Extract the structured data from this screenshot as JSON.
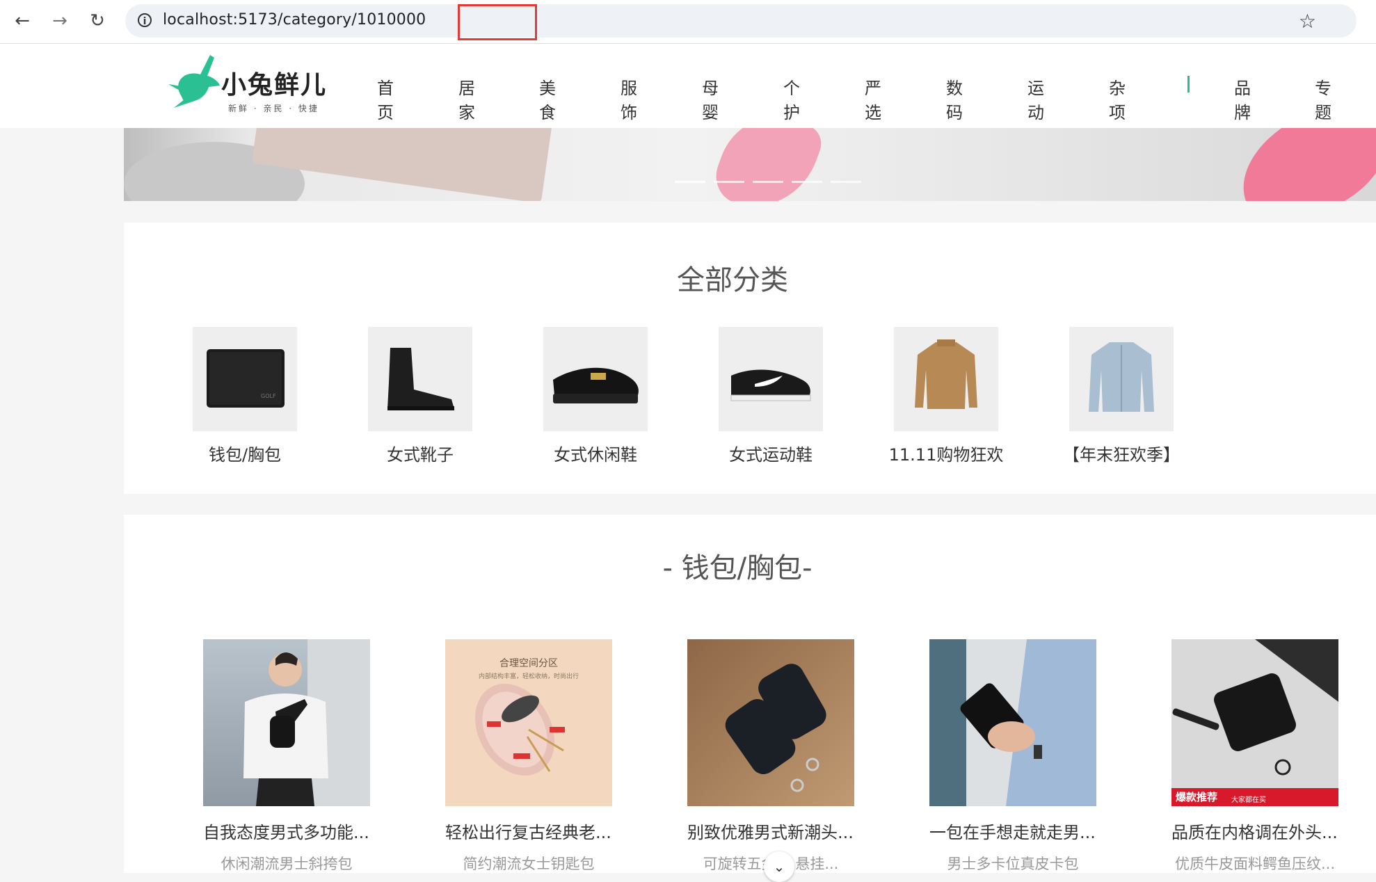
{
  "browser": {
    "url": "localhost:5173/category/1010000",
    "back_icon": "←",
    "forward_icon": "→",
    "reload_icon": "↻",
    "info_icon": "i",
    "star_icon": "☆"
  },
  "header": {
    "logo_title": "小兔鲜儿",
    "logo_sub": "新鲜 · 亲民 · 快捷",
    "nav": [
      "首页",
      "居家",
      "美食",
      "服饰",
      "母婴",
      "个护",
      "严选",
      "数码",
      "运动",
      "杂项"
    ],
    "nav_extra": [
      "品牌",
      "专题"
    ],
    "accent": "#27ba9b"
  },
  "categories": {
    "title": "全部分类",
    "items": [
      {
        "label": "钱包/胸包",
        "icon": "wallet-icon"
      },
      {
        "label": "女式靴子",
        "icon": "boot-icon"
      },
      {
        "label": "女式休闲鞋",
        "icon": "loafer-icon"
      },
      {
        "label": "女式运动鞋",
        "icon": "sneaker-icon"
      },
      {
        "label": "11.11购物狂欢",
        "icon": "sweater-icon"
      },
      {
        "label": "【年末狂欢季】",
        "icon": "jacket-icon"
      }
    ]
  },
  "section": {
    "title": "- 钱包/胸包-",
    "products": [
      {
        "name": "自我态度男式多功能...",
        "desc": "休闲潮流男士斜挎包"
      },
      {
        "name": "轻松出行复古经典老...",
        "desc": "简约潮流女士钥匙包",
        "img_title": "合理空间分区",
        "img_sub": "内部结构丰富，轻松收纳，时尚出行"
      },
      {
        "name": "别致优雅男式新潮头...",
        "desc": "可旋转五金扌  悬挂..."
      },
      {
        "name": "一包在手想走就走男...",
        "desc": "男士多卡位真皮卡包"
      },
      {
        "name": "品质在内格调在外头...",
        "desc": "优质牛皮面料鳄鱼压纹...",
        "badge": "爆款推荐",
        "badge_sub": "大家都在买"
      }
    ]
  },
  "scroll_icon": "⌄"
}
